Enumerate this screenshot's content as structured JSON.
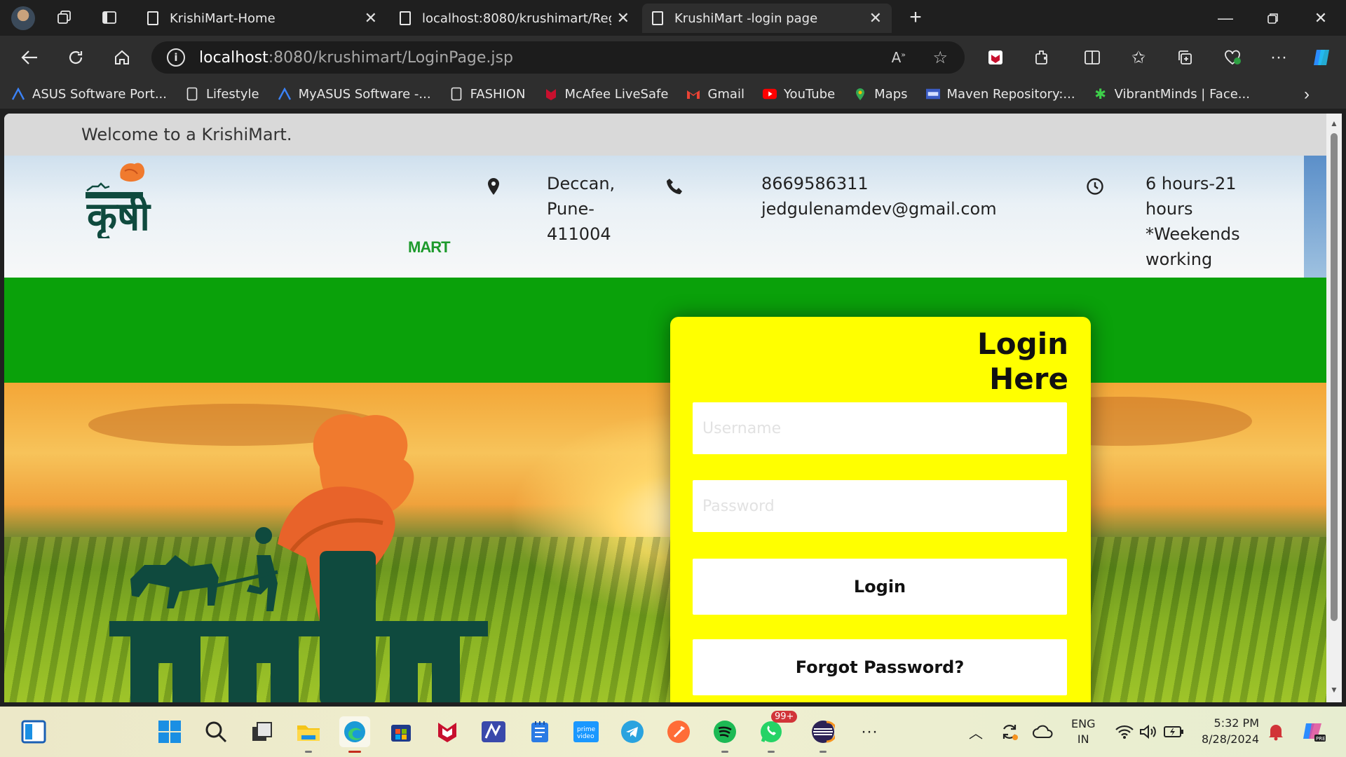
{
  "browser": {
    "tabs": [
      {
        "title": "KrishiMart-Home"
      },
      {
        "title": "localhost:8080/krushimart/RegNa"
      },
      {
        "title": "KrushiMart -login page",
        "active": true
      }
    ],
    "address": {
      "host": "localhost",
      "path": ":8080/krushimart/LoginPage.jsp"
    },
    "bookmarks": [
      {
        "label": "ASUS Software Port...",
        "icon": "asus-icon"
      },
      {
        "label": "Lifestyle",
        "icon": "document-icon"
      },
      {
        "label": "MyASUS Software -...",
        "icon": "asus-icon"
      },
      {
        "label": "FASHION",
        "icon": "document-icon"
      },
      {
        "label": "McAfee LiveSafe",
        "icon": "mcafee-icon"
      },
      {
        "label": "Gmail",
        "icon": "gmail-icon"
      },
      {
        "label": "YouTube",
        "icon": "youtube-icon"
      },
      {
        "label": "Maps",
        "icon": "maps-icon"
      },
      {
        "label": "Maven Repository:...",
        "icon": "maven-icon"
      },
      {
        "label": "VibrantMinds | Face...",
        "icon": "vibrantminds-icon"
      }
    ]
  },
  "page": {
    "welcome": "Welcome to a KrishiMart.",
    "brand": {
      "logo_text": "कृषी",
      "mart": "MART"
    },
    "address_lines": [
      "Deccan,",
      "Pune-",
      "411004"
    ],
    "contact": {
      "phone": "8669586311",
      "email": "jedgulenamdev@gmail.com"
    },
    "hours_lines": [
      "6 hours-21",
      "hours",
      "*Weekends",
      "working"
    ],
    "login": {
      "title_line1": "Login",
      "title_line2": "Here",
      "username_placeholder": "Username",
      "password_placeholder": "Password",
      "login_button": "Login",
      "forgot_button": "Forgot Password?"
    }
  },
  "taskbar": {
    "whatsapp_badge": "99+",
    "language": {
      "line1": "ENG",
      "line2": "IN"
    },
    "time": "5:32 PM",
    "date": "8/28/2024"
  },
  "colors": {
    "green_band": "#0aa10a",
    "login_card": "#ffff00",
    "brand_green": "#1d9a2c",
    "logo_dark": "#0f4a3e",
    "turban": "#f07a2e"
  }
}
